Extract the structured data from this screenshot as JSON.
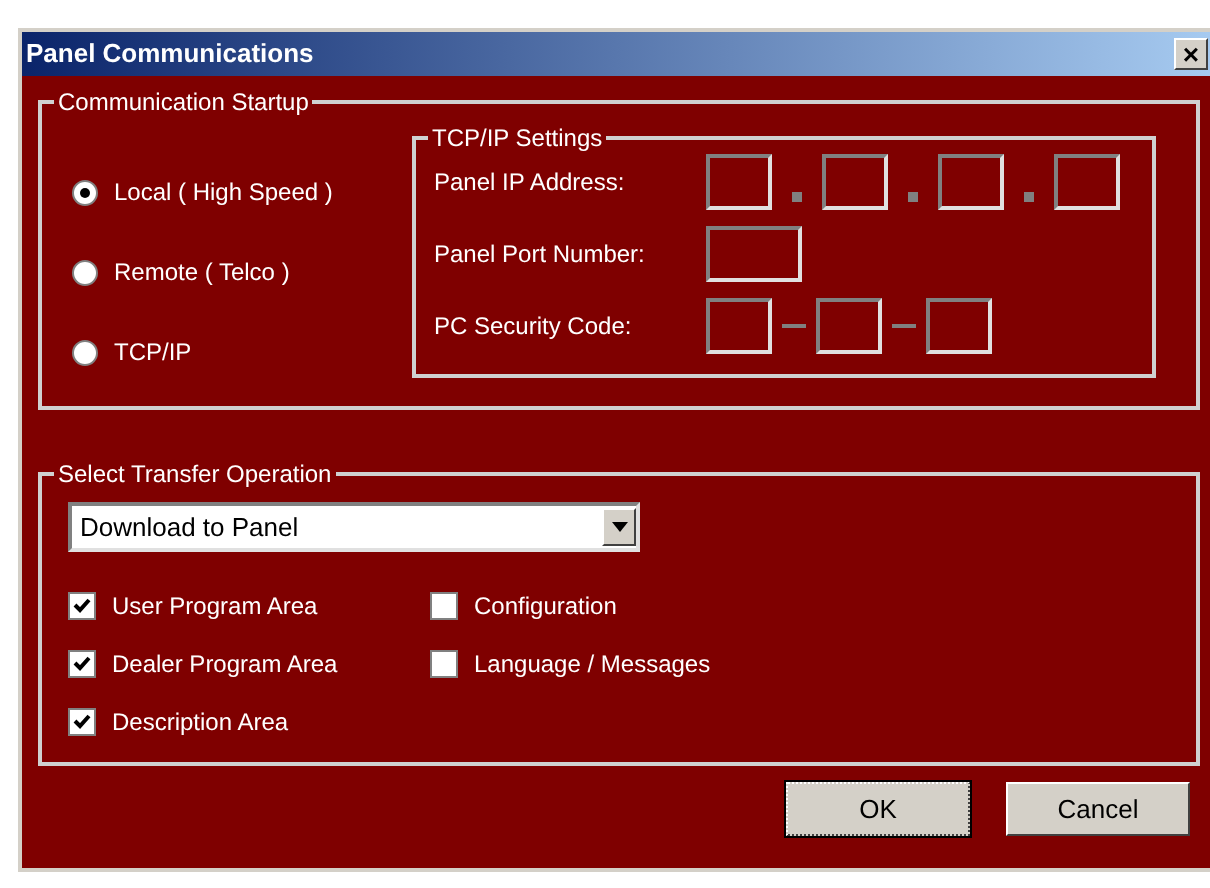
{
  "window": {
    "title": "Panel Communications",
    "close_glyph": "×"
  },
  "communication_startup": {
    "title": "Communication Startup",
    "modes": [
      {
        "label": "Local ( High Speed )",
        "selected": true
      },
      {
        "label": "Remote ( Telco )",
        "selected": false
      },
      {
        "label": "TCP/IP",
        "selected": false
      }
    ],
    "tcp_ip_settings": {
      "title": "TCP/IP Settings",
      "rows": [
        {
          "kind": "address",
          "label": "Panel IP Address:",
          "fields": [
            {
              "kind": "narrow"
            },
            {
              "kind": "narrow"
            },
            {
              "kind": "narrow"
            },
            {
              "kind": "narrow"
            }
          ]
        },
        {
          "kind": "port",
          "label": "Panel Port Number:",
          "fields": [
            {
              "kind": "wide"
            }
          ]
        },
        {
          "kind": "code",
          "label": "PC Security Code:",
          "fields": [
            {
              "kind": "narrow"
            },
            {
              "kind": "narrow"
            },
            {
              "kind": "narrow"
            }
          ]
        }
      ]
    }
  },
  "transfer": {
    "title": "Select Transfer Operation",
    "operation": "Download to Panel",
    "options": [
      {
        "label": "User Program Area",
        "checked": true
      },
      {
        "label": "Dealer Program Area",
        "checked": true
      },
      {
        "label": "Description Area",
        "checked": true
      },
      {
        "label": "Configuration",
        "checked": false
      },
      {
        "label": "Language / Messages",
        "checked": false
      }
    ]
  },
  "buttons": [
    {
      "label": "OK",
      "focused": true
    },
    {
      "label": "Cancel",
      "focused": false
    }
  ]
}
